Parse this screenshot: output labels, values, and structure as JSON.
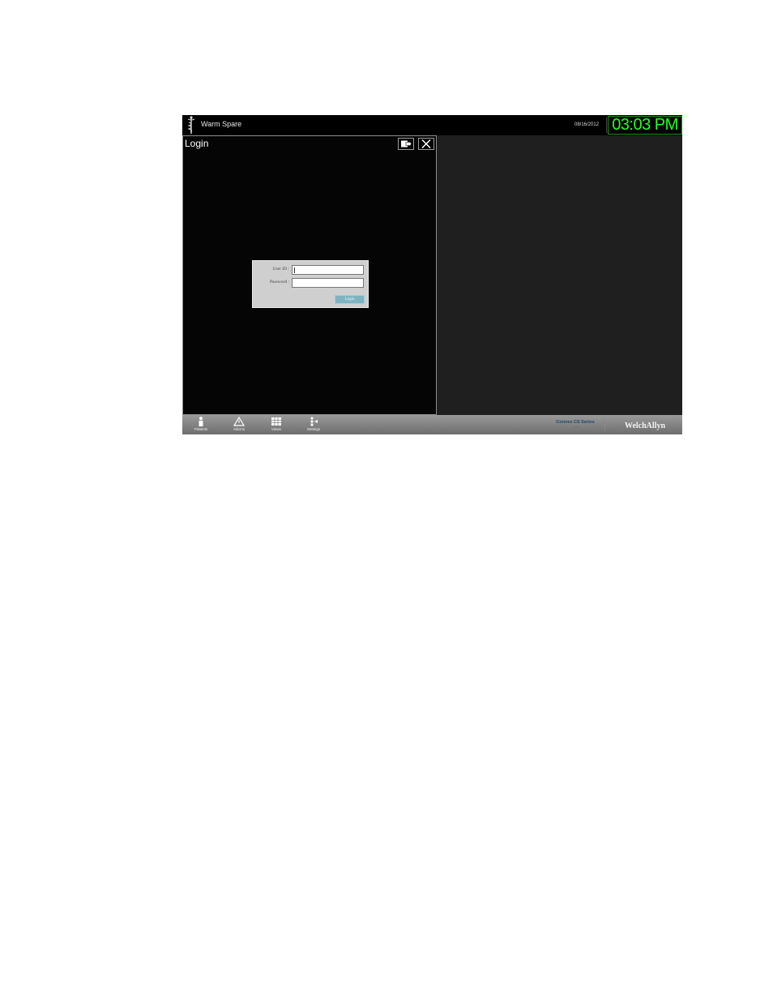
{
  "topbar": {
    "station_name": "Warm Spare",
    "date": "08/16/2012",
    "time": "03:03 PM"
  },
  "login_window": {
    "title": "Login",
    "user_id_label": "User ID :",
    "password_label": "Password :",
    "user_id_value": "",
    "password_value": "",
    "login_button": "Login"
  },
  "nav": {
    "items": [
      {
        "label": "Patients",
        "icon": "patient-icon"
      },
      {
        "label": "Alarms",
        "icon": "alarm-icon"
      },
      {
        "label": "Views",
        "icon": "grid-icon"
      },
      {
        "label": "Settings",
        "icon": "settings-icon"
      }
    ]
  },
  "product": {
    "name": "Connex CS Series",
    "version": "1.1.0.0"
  },
  "brand": "WelchAllyn",
  "colors": {
    "clock": "#22ff22",
    "login_button": "#7fb3c2",
    "dialog_bg": "#cfcfcf",
    "product_text": "#21476b"
  }
}
